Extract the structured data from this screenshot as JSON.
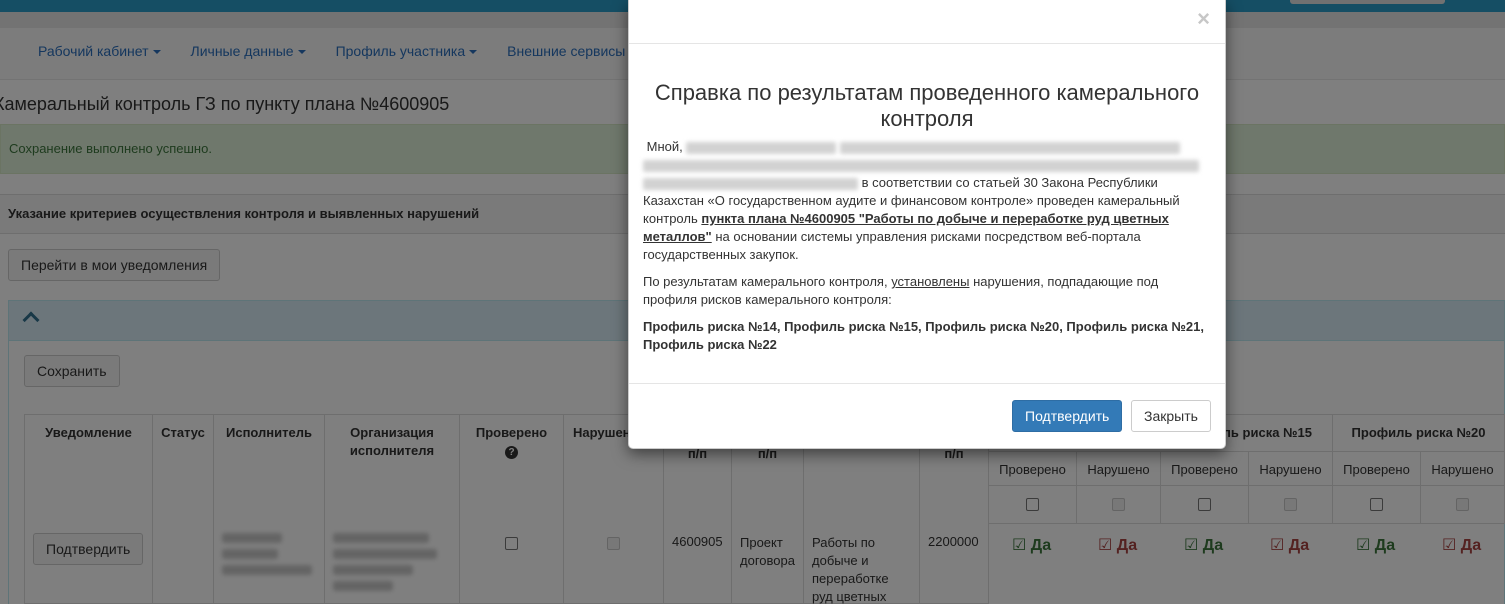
{
  "nav": {
    "items": [
      {
        "label": "Рабочий кабинет"
      },
      {
        "label": "Личные данные"
      },
      {
        "label": "Профиль участника"
      },
      {
        "label": "Внешние сервисы"
      }
    ]
  },
  "page": {
    "title": "Камеральный контроль ГЗ по пункту плана №4600905",
    "alert_success": "Сохранение выполнено успешно.",
    "section_title": "Указание критериев осуществления контроля и выявленных нарушений",
    "notify_button": "Перейти в мои уведомления",
    "save_button": "Сохранить"
  },
  "table": {
    "headers": {
      "notification": "Уведомление",
      "status": "Статус",
      "executor": "Исполнитель",
      "executor_org": "Организация исполнителя",
      "checked": "Проверено",
      "violated": "Нарушено",
      "pp": "п/п",
      "risk15": "Профиль риска №15",
      "risk20": "Профиль риска №20",
      "risk14_partial": "ль риска №15"
    },
    "sub_headers": {
      "checked": "Проверено",
      "violated": "Нарушено"
    },
    "row": {
      "confirm_button": "Подтвердить",
      "plan_number": "4600905",
      "doc_type": "Проект договора",
      "name": "Работы по добыче и переработке руд цветных",
      "amount": "2200000",
      "yes": "Да"
    }
  },
  "modal": {
    "title": "Справка по результатам проведенного камерального контроля",
    "p1_start": "Мной,",
    "p1_mid": "в соответствии со статьей 30 Закона Республики Казахстан «О государственном аудите и финансовом контроле» проведен камеральный контроль",
    "p1_link": "пункта плана №4600905 \"Работы по добыче и переработке руд цветных металлов\"",
    "p1_end": "на основании системы управления рисками посредством веб-портала государственных закупок.",
    "p2_start": "По результатам камерального контроля,",
    "p2_link": "установлены",
    "p2_end": "нарушения, подпадающие под профиля рисков камерального контроля:",
    "p3": "Профиль риска №14, Профиль риска №15, Профиль риска №20, Профиль риска №21, Профиль риска №22",
    "close_symbol": "×",
    "confirm_button": "Подтвердить",
    "close_button": "Закрыть"
  },
  "colors": {
    "primary": "#337ab7",
    "success_text": "#3c763d",
    "danger_text": "#a94442",
    "nav_link": "#2a6ebd"
  }
}
